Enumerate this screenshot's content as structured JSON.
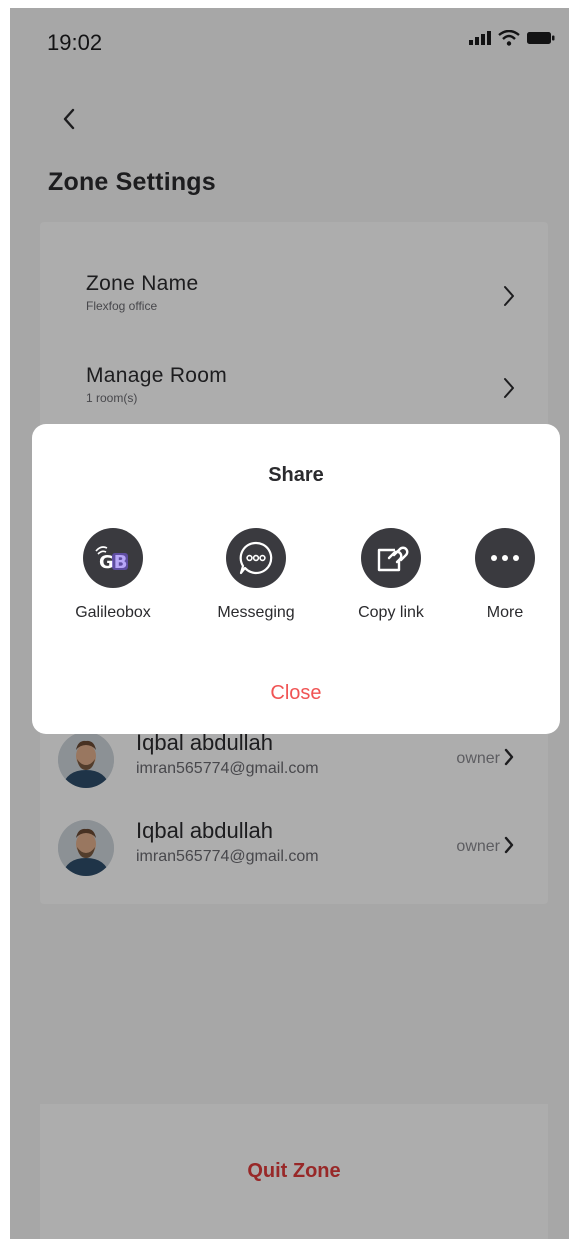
{
  "status_bar": {
    "time": "19:02"
  },
  "header": {
    "title": "Zone Settings"
  },
  "settings": [
    {
      "title": "Zone Name",
      "subtitle": "Flexfog office"
    },
    {
      "title": "Manage Room",
      "subtitle": "1 room(s)"
    }
  ],
  "members": [
    {
      "name": "Iqbal abdullah",
      "email": "imran565774@gmail.com",
      "role": "owner"
    },
    {
      "name": "Iqbal abdullah",
      "email": "imran565774@gmail.com",
      "role": "owner"
    }
  ],
  "footer": {
    "quit_label": "Quit Zone"
  },
  "share_sheet": {
    "title": "Share",
    "options": [
      {
        "label": "Galileobox",
        "icon": "galileobox-icon"
      },
      {
        "label": "Messeging",
        "icon": "message-icon"
      },
      {
        "label": "Copy link",
        "icon": "copy-link-icon"
      },
      {
        "label": "More",
        "icon": "more-icon"
      }
    ],
    "close_label": "Close",
    "logo_text": "GB"
  },
  "colors": {
    "danger": "#e03c3c",
    "close": "#f05454",
    "icon_bg": "#3a3a3f"
  }
}
